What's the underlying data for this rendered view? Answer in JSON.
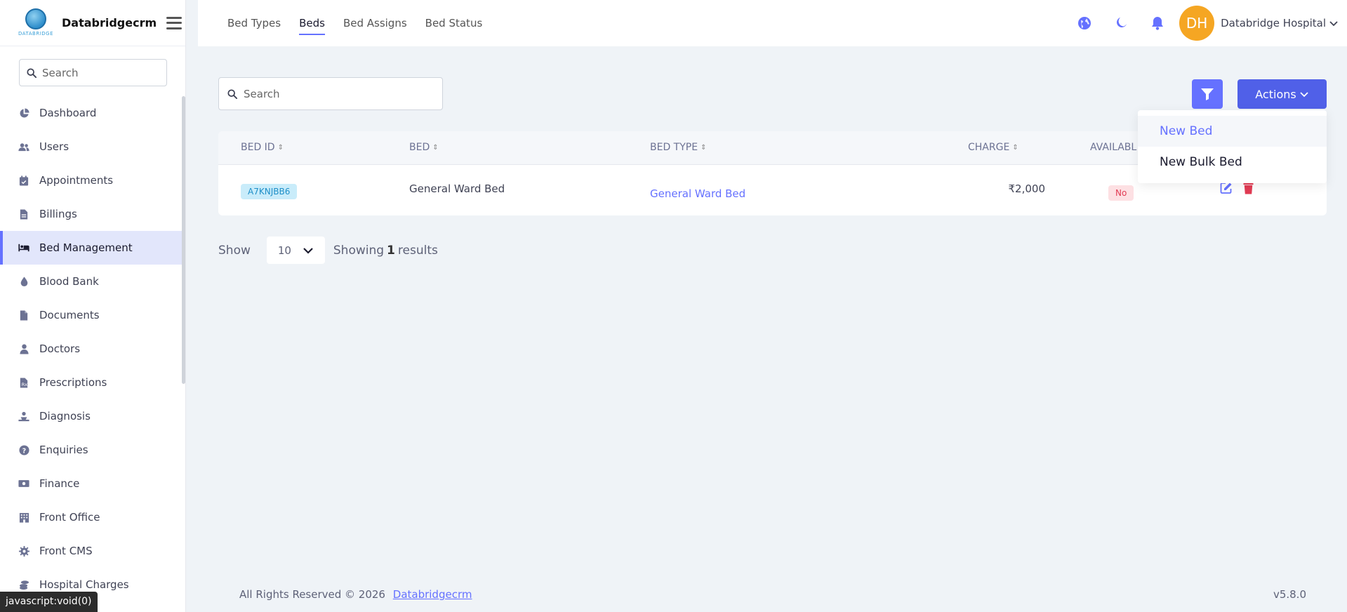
{
  "brand": {
    "name": "Databridgecrm",
    "logo_tag": "DATABRIDGE"
  },
  "sidebar": {
    "search_placeholder": "Search",
    "items": [
      {
        "label": "Dashboard",
        "icon": "pie-chart-icon"
      },
      {
        "label": "Users",
        "icon": "users-icon"
      },
      {
        "label": "Appointments",
        "icon": "calendar-check-icon"
      },
      {
        "label": "Billings",
        "icon": "invoice-icon"
      },
      {
        "label": "Bed Management",
        "icon": "bed-icon",
        "active": true
      },
      {
        "label": "Blood Bank",
        "icon": "blood-drop-icon"
      },
      {
        "label": "Documents",
        "icon": "file-icon"
      },
      {
        "label": "Doctors",
        "icon": "doctor-icon"
      },
      {
        "label": "Prescriptions",
        "icon": "prescription-icon"
      },
      {
        "label": "Diagnosis",
        "icon": "diagnosis-icon"
      },
      {
        "label": "Enquiries",
        "icon": "question-circle-icon"
      },
      {
        "label": "Finance",
        "icon": "money-icon"
      },
      {
        "label": "Front Office",
        "icon": "building-icon"
      },
      {
        "label": "Front CMS",
        "icon": "gear-icon"
      },
      {
        "label": "Hospital Charges",
        "icon": "coins-icon"
      }
    ]
  },
  "topbar": {
    "tabs": [
      {
        "label": "Bed Types"
      },
      {
        "label": "Beds",
        "active": true
      },
      {
        "label": "Bed Assigns"
      },
      {
        "label": "Bed Status"
      }
    ],
    "avatar_initials": "DH",
    "user_name": "Databridge Hospital"
  },
  "main": {
    "search_placeholder": "Search",
    "actions_label": "Actions",
    "dropdown": {
      "new_bed": "New Bed",
      "new_bulk_bed": "New Bulk Bed"
    },
    "table": {
      "headers": {
        "bed_id": "BED ID",
        "bed": "BED",
        "bed_type": "BED TYPE",
        "charge": "CHARGE",
        "available": "AVAILABL"
      },
      "rows": [
        {
          "bed_id": "A7KNJBB6",
          "bed": "General Ward Bed",
          "bed_type": "General Ward Bed",
          "charge": "₹2,000",
          "available": "No"
        }
      ]
    },
    "pager": {
      "show_label": "Show",
      "per_page": "10",
      "showing_prefix": "Showing",
      "count": "1",
      "results_suffix": "results"
    }
  },
  "footer": {
    "rights": "All Rights Reserved © 2026",
    "link": "Databridgecrm",
    "version": "v5.8.0"
  },
  "status_bar": "javascript:void(0)",
  "colors": {
    "accent": "#6571ff",
    "actions": "#5060e8",
    "avatar": "#f5a623",
    "danger": "#e23b53"
  }
}
